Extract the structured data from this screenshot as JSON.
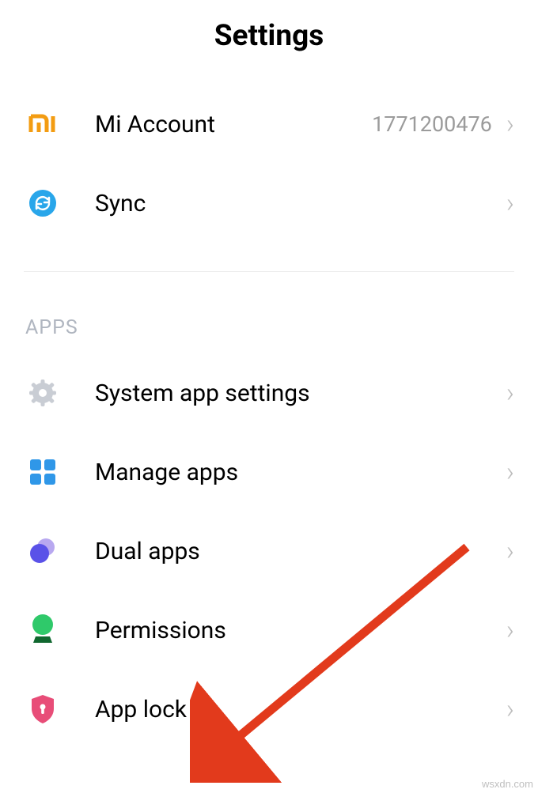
{
  "header": {
    "title": "Settings"
  },
  "account_section": {
    "items": [
      {
        "label": "Mi Account",
        "value": "1771200476"
      },
      {
        "label": "Sync",
        "value": ""
      }
    ]
  },
  "apps_section": {
    "header": "APPS",
    "items": [
      {
        "label": "System app settings"
      },
      {
        "label": "Manage apps"
      },
      {
        "label": "Dual apps"
      },
      {
        "label": "Permissions"
      },
      {
        "label": "App lock"
      }
    ]
  },
  "watermark": "wsxdn.com"
}
